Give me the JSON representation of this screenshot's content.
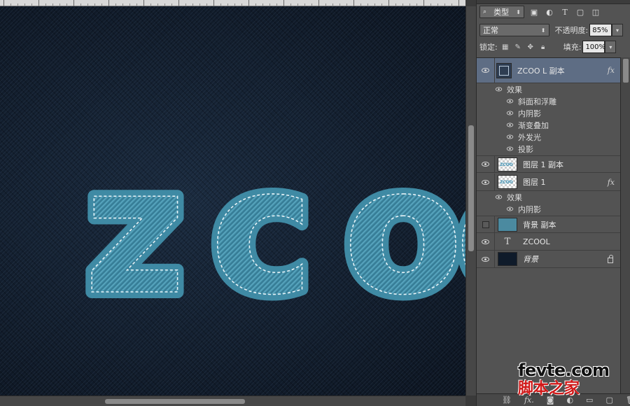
{
  "canvas": {
    "text": "ZCOO",
    "colors": {
      "fill": "#3f8aa4",
      "stitch": "#e8f4f8",
      "background": "#0f1a28"
    }
  },
  "panel": {
    "filter": {
      "kind": "类型",
      "icons": [
        "image-filter-icon",
        "adjustment-filter-icon",
        "type-filter-icon",
        "shape-filter-icon",
        "smartobject-filter-icon"
      ]
    },
    "blend": {
      "mode": "正常",
      "opacity_label": "不透明度:",
      "opacity_value": "85%"
    },
    "lock": {
      "label": "锁定:",
      "fill_label": "填充:",
      "fill_value": "100%"
    },
    "layers": [
      {
        "name": "ZCOO L 副本",
        "selected": true,
        "fx": "fx",
        "thumb": "smart"
      },
      {
        "name": "图层 1 副本",
        "thumb": "checker"
      },
      {
        "name": "图层 1",
        "fx": "fx",
        "thumb": "checker"
      },
      {
        "name": "背景 副本",
        "thumb": "teal",
        "hidden": true
      },
      {
        "name": "ZCOOL",
        "thumb": "type",
        "type_glyph": "T"
      },
      {
        "name": "背景",
        "thumb": "dark",
        "locked": true
      }
    ],
    "effects_group_1": {
      "header": "效果",
      "items": [
        "斜面和浮雕",
        "内阴影",
        "渐变叠加",
        "外发光",
        "投影"
      ]
    },
    "effects_group_2": {
      "header": "效果",
      "items": [
        "内阴影"
      ]
    },
    "footer": {
      "link": "⛓",
      "fx": "fx.",
      "mask": "◙",
      "adj": "◐",
      "folder": "▭",
      "new": "▢",
      "trash": "🗑"
    }
  },
  "watermark": {
    "main": "fevte.com",
    "sub": "脚本之家"
  }
}
